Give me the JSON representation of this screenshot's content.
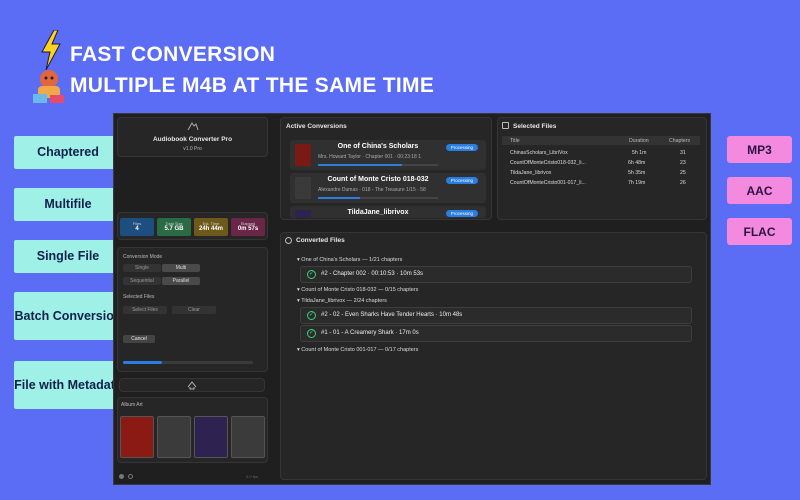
{
  "headline": {
    "line1": "FAST CONVERSION",
    "line2": "MULTIPLE M4B AT THE SAME TIME"
  },
  "features": [
    "Chaptered",
    "Multifile",
    "Single File",
    "Batch Conversion",
    "File with Metadata"
  ],
  "formats": [
    "MP3",
    "AAC",
    "FLAC"
  ],
  "app": {
    "name": "Audiobook Converter Pro",
    "version": "v1.0 Pro",
    "stats": [
      {
        "label": "Files",
        "value": "4",
        "color": "#1e4d80"
      },
      {
        "label": "Total Size",
        "value": "5.7 GB",
        "color": "#2a6a45"
      },
      {
        "label": "Est. Time",
        "value": "24h 44m",
        "color": "#6d5a1b"
      },
      {
        "label": "Elapsed",
        "value": "0m 57s",
        "color": "#6a2547"
      }
    ],
    "conversion_mode_label": "Conversion Mode",
    "modes": [
      "Single",
      "Multi"
    ],
    "mode_selected": "Multi",
    "orders": [
      "Sequential",
      "Parallel"
    ],
    "order_selected": "Parallel",
    "selected_files_label": "Selected Files",
    "select_files_btn": "Select Files",
    "clear_btn": "Clear",
    "cancel_btn": "Cancel",
    "album_art_label": "Album Art",
    "progress": 0.3,
    "footer_right": "0.0 fps"
  },
  "active": {
    "title": "Active Conversions",
    "items": [
      {
        "title": "One of China's Scholars",
        "sub": "Mrs. Howard Taylor · Chapter 001 · 00:23:18 1",
        "status": "Processing",
        "progress": 0.7
      },
      {
        "title": "Count of Monte Cristo 018-032",
        "sub": "Alexandre Dumas · 018 - The Treasure 1/15 · 58",
        "status": "Processing",
        "progress": 0.35
      },
      {
        "title": "TildaJane_librivox",
        "sub": "",
        "status": "Processing",
        "progress": 0.2
      }
    ]
  },
  "selected": {
    "title": "Selected Files",
    "headers": {
      "title": "Title",
      "duration": "Duration",
      "chapters": "Chapters"
    },
    "rows": [
      {
        "title": "ChinasScholars_LibriVox",
        "duration": "5h 1m",
        "chapters": "31"
      },
      {
        "title": "CountOfMonteCristo018-032_li...",
        "duration": "6h 48m",
        "chapters": "23"
      },
      {
        "title": "TildaJane_librivox",
        "duration": "5h 35m",
        "chapters": "25"
      },
      {
        "title": "CountOfMonteCristo001-017_li...",
        "duration": "7h 19m",
        "chapters": "26"
      }
    ]
  },
  "converted": {
    "title": "Converted Files",
    "groups": [
      {
        "label": "One of China's Scholars — 1/21 chapters"
      },
      {
        "label": "Count of Monte Cristo 018-032 — 0/15 chapters"
      },
      {
        "label": "TildaJane_librivox — 2/24 chapters"
      },
      {
        "label": "Count of Monte Cristo 001-017 — 0/17 chapters"
      }
    ],
    "items": [
      {
        "text": "#2 - Chapter 002 · 00:10:53 · 10m 53s"
      },
      {
        "text": "#2 - 02 - Even Sharks Have Tender Hearts · 10m 48s"
      },
      {
        "text": "#1 - 01 - A Creamery Shark · 17m 0s"
      }
    ]
  }
}
